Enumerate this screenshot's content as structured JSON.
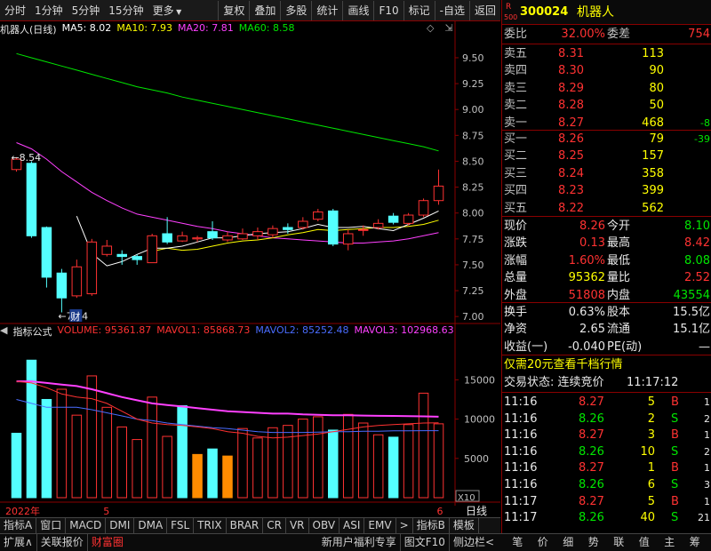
{
  "toolbar": {
    "left": [
      "分时",
      "1分钟",
      "5分钟",
      "15分钟",
      "更多"
    ],
    "right": [
      "复权",
      "叠加",
      "多股",
      "统计",
      "画线",
      "F10",
      "标记",
      "-自选",
      "返回"
    ]
  },
  "chart_data": [
    {
      "type": "candlestick",
      "title": "机器人(日线)",
      "legend": [
        {
          "name": "MA5",
          "value": "8.02",
          "color": "#ffffff"
        },
        {
          "name": "MA10",
          "value": "7.93",
          "color": "#ffff00"
        },
        {
          "name": "MA20",
          "value": "7.81",
          "color": "#ff40ff"
        },
        {
          "name": "MA60",
          "value": "8.58",
          "color": "#00e600"
        }
      ],
      "ylim": [
        6.95,
        9.68
      ],
      "yticks": [
        "9.50",
        "9.25",
        "9.00",
        "8.75",
        "8.50",
        "8.25",
        "8.00",
        "7.75",
        "7.50",
        "7.25",
        "7.00"
      ],
      "annotations": [
        "8.54",
        "7.04",
        "财"
      ],
      "candles": [
        {
          "o": 8.42,
          "c": 8.52,
          "h": 8.54,
          "l": 8.4
        },
        {
          "o": 8.48,
          "c": 7.78,
          "h": 8.5,
          "l": 7.76
        },
        {
          "o": 7.86,
          "c": 7.38,
          "h": 7.87,
          "l": 7.28
        },
        {
          "o": 7.42,
          "c": 7.18,
          "h": 7.46,
          "l": 7.04
        },
        {
          "o": 7.2,
          "c": 7.48,
          "h": 7.55,
          "l": 7.18
        },
        {
          "o": 7.22,
          "c": 7.72,
          "h": 7.75,
          "l": 7.2
        },
        {
          "o": 7.6,
          "c": 7.68,
          "h": 7.74,
          "l": 7.58
        },
        {
          "o": 7.6,
          "c": 7.58,
          "h": 7.64,
          "l": 7.5
        },
        {
          "o": 7.58,
          "c": 7.55,
          "h": 7.6,
          "l": 7.5
        },
        {
          "o": 7.52,
          "c": 7.78,
          "h": 7.8,
          "l": 7.52
        },
        {
          "o": 7.8,
          "c": 7.72,
          "h": 7.96,
          "l": 7.7
        },
        {
          "o": 7.73,
          "c": 7.78,
          "h": 7.82,
          "l": 7.72
        },
        {
          "o": 7.75,
          "c": 7.76,
          "h": 7.78,
          "l": 7.72
        },
        {
          "o": 7.82,
          "c": 7.76,
          "h": 7.92,
          "l": 7.74
        },
        {
          "o": 7.74,
          "c": 7.78,
          "h": 7.82,
          "l": 7.72
        },
        {
          "o": 7.75,
          "c": 7.8,
          "h": 7.85,
          "l": 7.74
        },
        {
          "o": 7.78,
          "c": 7.82,
          "h": 7.86,
          "l": 7.74
        },
        {
          "o": 7.79,
          "c": 7.85,
          "h": 7.88,
          "l": 7.76
        },
        {
          "o": 7.86,
          "c": 7.84,
          "h": 7.9,
          "l": 7.8
        },
        {
          "o": 7.86,
          "c": 7.92,
          "h": 7.96,
          "l": 7.84
        },
        {
          "o": 7.94,
          "c": 8.01,
          "h": 8.04,
          "l": 7.92
        },
        {
          "o": 8.02,
          "c": 7.7,
          "h": 8.04,
          "l": 7.68
        },
        {
          "o": 7.7,
          "c": 7.8,
          "h": 7.84,
          "l": 7.64
        },
        {
          "o": 7.84,
          "c": 7.84,
          "h": 7.88,
          "l": 7.78
        },
        {
          "o": 7.86,
          "c": 7.9,
          "h": 7.94,
          "l": 7.84
        },
        {
          "o": 7.97,
          "c": 7.91,
          "h": 8.0,
          "l": 7.89
        },
        {
          "o": 7.9,
          "c": 7.98,
          "h": 8.0,
          "l": 7.88
        },
        {
          "o": 7.98,
          "c": 8.12,
          "h": 8.14,
          "l": 7.96
        },
        {
          "o": 8.12,
          "c": 8.26,
          "h": 8.42,
          "l": 8.08
        }
      ],
      "ma5": [
        null,
        null,
        null,
        null,
        7.97,
        7.61,
        7.49,
        7.53,
        7.6,
        7.66,
        7.66,
        7.68,
        7.72,
        7.76,
        7.76,
        7.78,
        7.8,
        7.81,
        7.82,
        7.85,
        7.89,
        7.86,
        7.86,
        7.87,
        7.85,
        7.83,
        7.89,
        7.95,
        8.02
      ],
      "ma10": [
        null,
        null,
        null,
        null,
        null,
        null,
        null,
        null,
        null,
        7.63,
        7.66,
        7.64,
        7.65,
        7.68,
        7.71,
        7.73,
        7.74,
        7.76,
        7.79,
        7.81,
        7.84,
        7.83,
        7.84,
        7.85,
        7.86,
        7.86,
        7.87,
        7.89,
        7.93
      ],
      "ma20": [
        8.68,
        8.62,
        8.52,
        8.4,
        8.3,
        8.2,
        8.12,
        8.05,
        7.99,
        7.96,
        7.93,
        7.9,
        7.87,
        7.85,
        7.82,
        7.8,
        7.78,
        7.76,
        7.75,
        7.74,
        7.73,
        7.72,
        7.71,
        7.71,
        7.72,
        7.73,
        7.75,
        7.78,
        7.81
      ],
      "ma60": [
        9.54,
        9.5,
        9.46,
        9.42,
        9.38,
        9.34,
        9.3,
        9.26,
        9.22,
        9.19,
        9.16,
        9.12,
        9.09,
        9.06,
        9.03,
        9.0,
        8.97,
        8.94,
        8.91,
        8.88,
        8.85,
        8.82,
        8.79,
        8.76,
        8.73,
        8.7,
        8.67,
        8.64,
        8.6
      ]
    },
    {
      "type": "bar",
      "title": "指标公式",
      "legend": [
        {
          "name": "VOLUME",
          "value": "95361.87",
          "color": "#ff3232"
        },
        {
          "name": "MAVOL1",
          "value": "85868.73",
          "color": "#ff3232"
        },
        {
          "name": "MAVOL2",
          "value": "85252.48",
          "color": "#4a6cff"
        },
        {
          "name": "MAVOL3",
          "value": "102968.63",
          "color": "#ff40ff"
        }
      ],
      "ylim": [
        0,
        19000
      ],
      "yticks": [
        "15000",
        "10000",
        "5000"
      ],
      "unit": "X10",
      "values": [
        8200,
        17500,
        12500,
        13800,
        10500,
        15500,
        11500,
        9000,
        7400,
        12800,
        7800,
        11700,
        5500,
        6200,
        5300,
        8800,
        7600,
        8900,
        9200,
        10000,
        10300,
        8600,
        10600,
        9500,
        8000,
        7700,
        9300,
        13300,
        9400
      ],
      "colors": [
        "cyan",
        "cyan",
        "cyan",
        "red",
        "red",
        "red",
        "red",
        "red",
        "red",
        "red",
        "red",
        "cyan",
        "orange",
        "cyan",
        "orange",
        "red",
        "red",
        "red",
        "red",
        "red",
        "red",
        "cyan",
        "red",
        "red",
        "red",
        "cyan",
        "red",
        "red",
        "red"
      ],
      "mavol1": [
        14800,
        14600,
        14000,
        13200,
        12800,
        12600,
        12000,
        11000,
        10000,
        9500,
        9300,
        9200,
        9000,
        8800,
        8400,
        8200,
        7800,
        7600,
        7700,
        7900,
        8100,
        8400,
        8700,
        9000,
        9200,
        9300,
        9400,
        9500,
        9537
      ],
      "mavol2": [
        12500,
        12000,
        11500,
        11500,
        11500,
        11200,
        10800,
        10400,
        10000,
        9800,
        9500,
        9300,
        9100,
        8900,
        8800,
        8600,
        8400,
        8300,
        8300,
        8300,
        8350,
        8400,
        8400,
        8450,
        8450,
        8500,
        8520,
        8530,
        8525
      ],
      "mavol3": [
        14800,
        14800,
        14600,
        14400,
        14200,
        13800,
        13300,
        12800,
        12400,
        12000,
        11800,
        11600,
        11400,
        11200,
        11000,
        10900,
        10800,
        10700,
        10700,
        10600,
        10550,
        10500,
        10480,
        10450,
        10420,
        10400,
        10380,
        10350,
        10300
      ]
    }
  ],
  "axis": {
    "year": "2022年",
    "m5": "5",
    "m6": "6",
    "period": "日线"
  },
  "bottombar": [
    "指标A",
    "窗口",
    "MACD",
    "DMI",
    "DMA",
    "FSL",
    "TRIX",
    "BRAR",
    "CR",
    "VR",
    "OBV",
    "ASI",
    "EMV",
    "指标B",
    "模板"
  ],
  "statusbar": {
    "left": [
      "扩展∧",
      "关联报价",
      "财富圈"
    ],
    "mid": [
      "新用户福利专享",
      "图文F10",
      "侧边栏<"
    ],
    "right": [
      "笔",
      "价",
      "细",
      "势",
      "联",
      "值",
      "主",
      "筹"
    ]
  },
  "stock": {
    "badge_r": "R",
    "badge_500": "500",
    "code": "300024",
    "name": "机器人"
  },
  "weibi": {
    "label": "委比",
    "value": "32.00%",
    "label2": "委差",
    "value2": "754"
  },
  "asks": [
    {
      "label": "卖五",
      "price": "8.31",
      "vol": "113",
      "chg": ""
    },
    {
      "label": "卖四",
      "price": "8.30",
      "vol": "90",
      "chg": ""
    },
    {
      "label": "卖三",
      "price": "8.29",
      "vol": "80",
      "chg": ""
    },
    {
      "label": "卖二",
      "price": "8.28",
      "vol": "50",
      "chg": ""
    },
    {
      "label": "卖一",
      "price": "8.27",
      "vol": "468",
      "chg": "-8"
    }
  ],
  "bids": [
    {
      "label": "买一",
      "price": "8.26",
      "vol": "79",
      "chg": "-39"
    },
    {
      "label": "买二",
      "price": "8.25",
      "vol": "157",
      "chg": ""
    },
    {
      "label": "买三",
      "price": "8.24",
      "vol": "358",
      "chg": ""
    },
    {
      "label": "买四",
      "price": "8.23",
      "vol": "399",
      "chg": ""
    },
    {
      "label": "买五",
      "price": "8.22",
      "vol": "562",
      "chg": ""
    }
  ],
  "quote": [
    {
      "l1": "现价",
      "v1": "8.26",
      "c1": "red",
      "l2": "今开",
      "v2": "8.10",
      "c2": "grn"
    },
    {
      "l1": "涨跌",
      "v1": "0.13",
      "c1": "red",
      "l2": "最高",
      "v2": "8.42",
      "c2": "red"
    },
    {
      "l1": "涨幅",
      "v1": "1.60%",
      "c1": "red",
      "l2": "最低",
      "v2": "8.08",
      "c2": "grn"
    },
    {
      "l1": "总量",
      "v1": "95362",
      "c1": "yel",
      "l2": "量比",
      "v2": "2.52",
      "c2": "red"
    },
    {
      "l1": "外盘",
      "v1": "51808",
      "c1": "red",
      "l2": "内盘",
      "v2": "43554",
      "c2": "grn"
    }
  ],
  "fund": [
    {
      "l1": "换手",
      "v1": "0.63%",
      "l2": "股本",
      "v2": "15.5亿"
    },
    {
      "l1": "净资",
      "v1": "2.65",
      "l2": "流通",
      "v2": "15.1亿"
    },
    {
      "l1": "收益(一)",
      "v1": "-0.040",
      "l2": "PE(动)",
      "v2": "—"
    }
  ],
  "promo": "仅需20元查看千档行情",
  "trade_status": {
    "label": "交易状态: 连续竞价",
    "time": "11:17:12"
  },
  "ticks": [
    {
      "t": "11:16",
      "p": "8.27",
      "v": "5",
      "s": "B",
      "n": "1"
    },
    {
      "t": "11:16",
      "p": "8.26",
      "v": "2",
      "s": "S",
      "n": "2"
    },
    {
      "t": "11:16",
      "p": "8.27",
      "v": "3",
      "s": "B",
      "n": "1"
    },
    {
      "t": "11:16",
      "p": "8.26",
      "v": "10",
      "s": "S",
      "n": "2"
    },
    {
      "t": "11:16",
      "p": "8.27",
      "v": "1",
      "s": "B",
      "n": "1"
    },
    {
      "t": "11:16",
      "p": "8.26",
      "v": "6",
      "s": "S",
      "n": "3"
    },
    {
      "t": "11:17",
      "p": "8.27",
      "v": "5",
      "s": "B",
      "n": "1"
    },
    {
      "t": "11:17",
      "p": "8.26",
      "v": "40",
      "s": "S",
      "n": "21"
    }
  ]
}
